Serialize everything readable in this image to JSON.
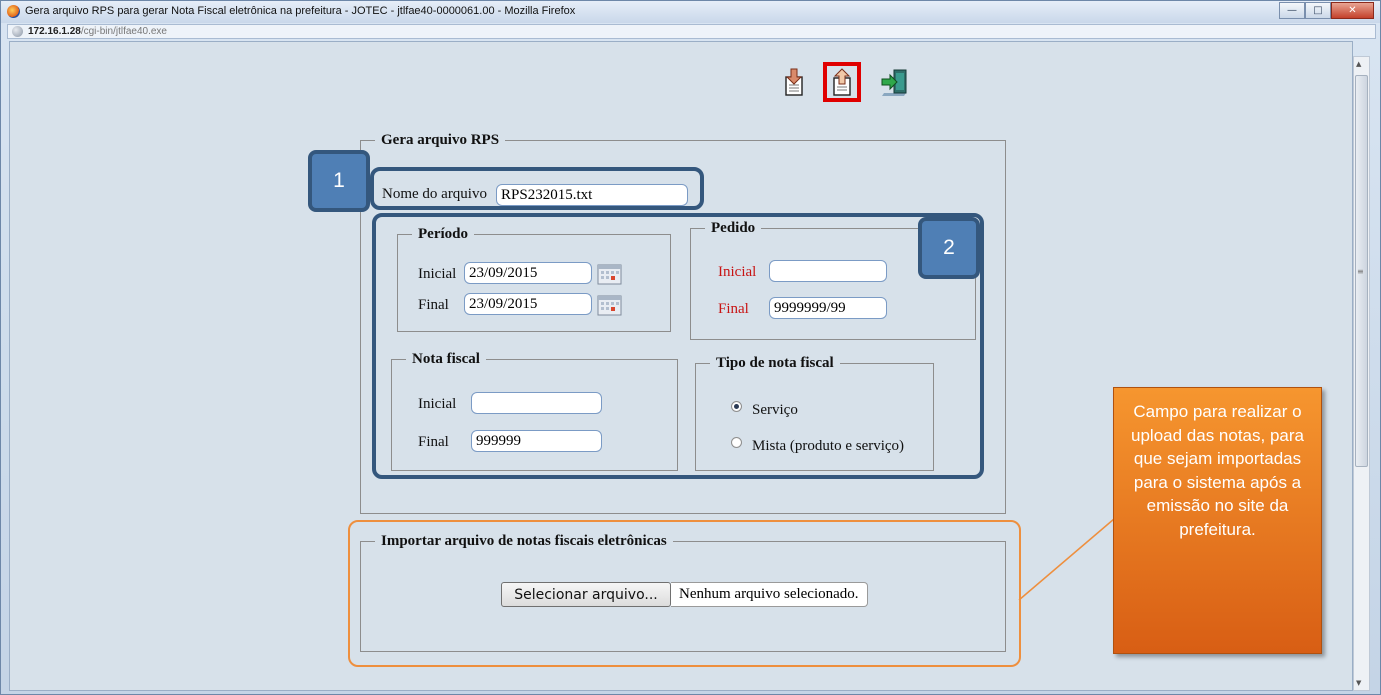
{
  "window": {
    "title": "Gera arquivo RPS para gerar Nota Fiscal eletrônica na prefeitura - JOTEC - jtlfae40-0000061.00 - Mozilla Firefox",
    "url_host": "172.16.1.28",
    "url_path": "/cgi-bin/jtlfae40.exe"
  },
  "toolbar": {
    "buttons": [
      {
        "icon": "export-document-icon",
        "highlighted": false
      },
      {
        "icon": "upload-document-icon",
        "highlighted": true
      },
      {
        "icon": "exit-door-icon",
        "highlighted": false
      }
    ]
  },
  "gera_rps": {
    "legend": "Gera arquivo RPS",
    "nome_label": "Nome do arquivo",
    "nome_value": "RPS232015.txt",
    "periodo": {
      "legend": "Período",
      "inicial_label": "Inicial",
      "inicial_value": "23/09/2015",
      "final_label": "Final",
      "final_value": "23/09/2015"
    },
    "pedido": {
      "legend": "Pedido",
      "inicial_label": "Inicial",
      "inicial_value": "",
      "final_label": "Final",
      "final_value": "9999999/99"
    },
    "nota_fiscal": {
      "legend": "Nota fiscal",
      "inicial_label": "Inicial",
      "inicial_value": "",
      "final_label": "Final",
      "final_value": "999999"
    },
    "tipo": {
      "legend": "Tipo de nota fiscal",
      "options": [
        "Serviço",
        "Mista (produto e serviço)"
      ],
      "selected": "Serviço"
    }
  },
  "importar": {
    "legend": "Importar arquivo de notas fiscais eletrônicas",
    "button_label": "Selecionar arquivo...",
    "status": "Nenhum arquivo selecionado."
  },
  "annotations": {
    "badge1": "1",
    "badge2": "2",
    "callout": "Campo para realizar o upload das notas, para que sejam importadas para o sistema após a emissão no site da prefeitura."
  },
  "colors": {
    "highlight_red": "#e00000",
    "callout_blue": "#34577d",
    "badge_blue": "#4f7fb5",
    "callout_orange": "#ee8f3e",
    "tooltip_orange": "#e8741d",
    "label_red": "#c81414"
  }
}
